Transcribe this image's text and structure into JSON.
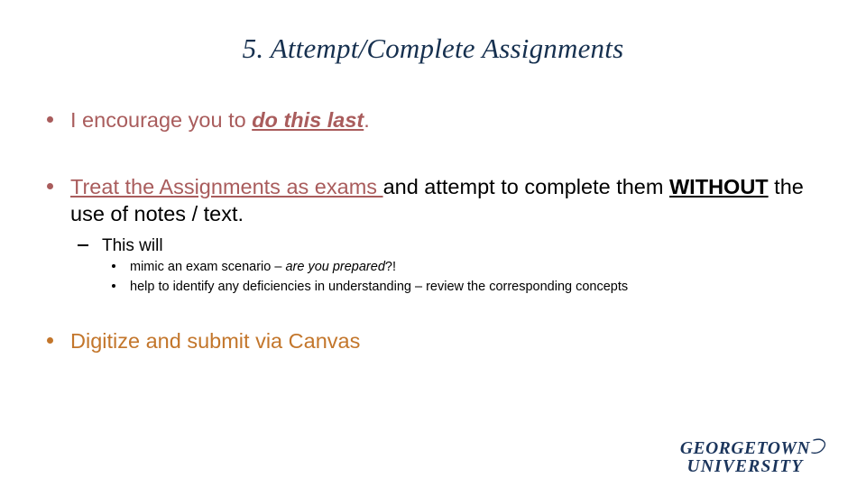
{
  "slide": {
    "title": "5. Attempt/Complete Assignments",
    "background_color": "#ffffff",
    "title_color": "#16304f",
    "accent_red": "#a95c5c",
    "accent_orange": "#c3762b"
  },
  "bullets": {
    "b1": {
      "lead": "I encourage you to ",
      "emphasis": "do this last",
      "tail": "."
    },
    "b2": {
      "underlined_red": "Treat the Assignments as exams ",
      "black_1": "and attempt to complete them ",
      "bold_underline": "WITHOUT",
      "black_2": " the use of notes / text."
    },
    "b2_sub": {
      "dash_item": "This will",
      "items": [
        {
          "lead": "mimic an exam scenario – ",
          "italic": "are you prepared",
          "tail": "?!"
        },
        {
          "text": "help to identify any deficiencies in understanding – review the corresponding concepts"
        }
      ]
    },
    "b3": {
      "word_1": "Digitize",
      "middle": " and submit via ",
      "word_2": "Canvas"
    }
  },
  "logo": {
    "line1": "GEORGETOWN",
    "line2": "UNIVERSITY",
    "color": "#1b355c"
  }
}
